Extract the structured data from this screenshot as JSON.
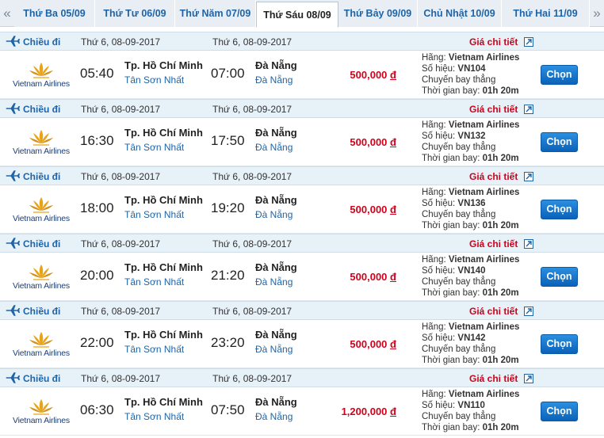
{
  "day_tabs": {
    "prev_arrow": "«",
    "next_arrow": "»",
    "tabs": [
      {
        "label": "Thứ Ba 05/09",
        "active": false
      },
      {
        "label": "Thứ Tư 06/09",
        "active": false
      },
      {
        "label": "Thứ Năm 07/09",
        "active": false
      },
      {
        "label": "Thứ Sáu 08/09",
        "active": true
      },
      {
        "label": "Thứ Bảy 09/09",
        "active": false
      },
      {
        "label": "Chủ Nhật 10/09",
        "active": false
      },
      {
        "label": "Thứ Hai 11/09",
        "active": false
      }
    ]
  },
  "labels": {
    "direction": "Chiều đi",
    "detail": "Giá chi tiết",
    "airline_prefix": "Hãng:",
    "flight_no_prefix": "Số hiệu:",
    "flight_type": "Chuyến bay thẳng",
    "duration_prefix": "Thời gian bay:",
    "choose": "Chọn",
    "logo_text": "Vietnam Airlines",
    "currency": "đ"
  },
  "colors": {
    "accent_blue": "#1e64a8",
    "price_red": "#d0021b",
    "logo_gold": "#e8a317"
  },
  "flights": [
    {
      "date_from": "Thứ 6, 08-09-2017",
      "date_to": "Thứ 6, 08-09-2017",
      "dep_time": "05:40",
      "from_city": "Tp. Hồ Chí Minh",
      "from_airport": "Tân Sơn Nhất",
      "arr_time": "07:00",
      "to_city": "Đà Nẵng",
      "to_airport": "Đà Nẵng",
      "price": "500,000",
      "airline": "Vietnam Airlines",
      "flight_no": "VN104",
      "duration": "01h 20m"
    },
    {
      "date_from": "Thứ 6, 08-09-2017",
      "date_to": "Thứ 6, 08-09-2017",
      "dep_time": "16:30",
      "from_city": "Tp. Hồ Chí Minh",
      "from_airport": "Tân Sơn Nhất",
      "arr_time": "17:50",
      "to_city": "Đà Nẵng",
      "to_airport": "Đà Nẵng",
      "price": "500,000",
      "airline": "Vietnam Airlines",
      "flight_no": "VN132",
      "duration": "01h 20m"
    },
    {
      "date_from": "Thứ 6, 08-09-2017",
      "date_to": "Thứ 6, 08-09-2017",
      "dep_time": "18:00",
      "from_city": "Tp. Hồ Chí Minh",
      "from_airport": "Tân Sơn Nhất",
      "arr_time": "19:20",
      "to_city": "Đà Nẵng",
      "to_airport": "Đà Nẵng",
      "price": "500,000",
      "airline": "Vietnam Airlines",
      "flight_no": "VN136",
      "duration": "01h 20m"
    },
    {
      "date_from": "Thứ 6, 08-09-2017",
      "date_to": "Thứ 6, 08-09-2017",
      "dep_time": "20:00",
      "from_city": "Tp. Hồ Chí Minh",
      "from_airport": "Tân Sơn Nhất",
      "arr_time": "21:20",
      "to_city": "Đà Nẵng",
      "to_airport": "Đà Nẵng",
      "price": "500,000",
      "airline": "Vietnam Airlines",
      "flight_no": "VN140",
      "duration": "01h 20m"
    },
    {
      "date_from": "Thứ 6, 08-09-2017",
      "date_to": "Thứ 6, 08-09-2017",
      "dep_time": "22:00",
      "from_city": "Tp. Hồ Chí Minh",
      "from_airport": "Tân Sơn Nhất",
      "arr_time": "23:20",
      "to_city": "Đà Nẵng",
      "to_airport": "Đà Nẵng",
      "price": "500,000",
      "airline": "Vietnam Airlines",
      "flight_no": "VN142",
      "duration": "01h 20m"
    },
    {
      "date_from": "Thứ 6, 08-09-2017",
      "date_to": "Thứ 6, 08-09-2017",
      "dep_time": "06:30",
      "from_city": "Tp. Hồ Chí Minh",
      "from_airport": "Tân Sơn Nhất",
      "arr_time": "07:50",
      "to_city": "Đà Nẵng",
      "to_airport": "Đà Nẵng",
      "price": "1,200,000",
      "airline": "Vietnam Airlines",
      "flight_no": "VN110",
      "duration": "01h 20m"
    }
  ]
}
